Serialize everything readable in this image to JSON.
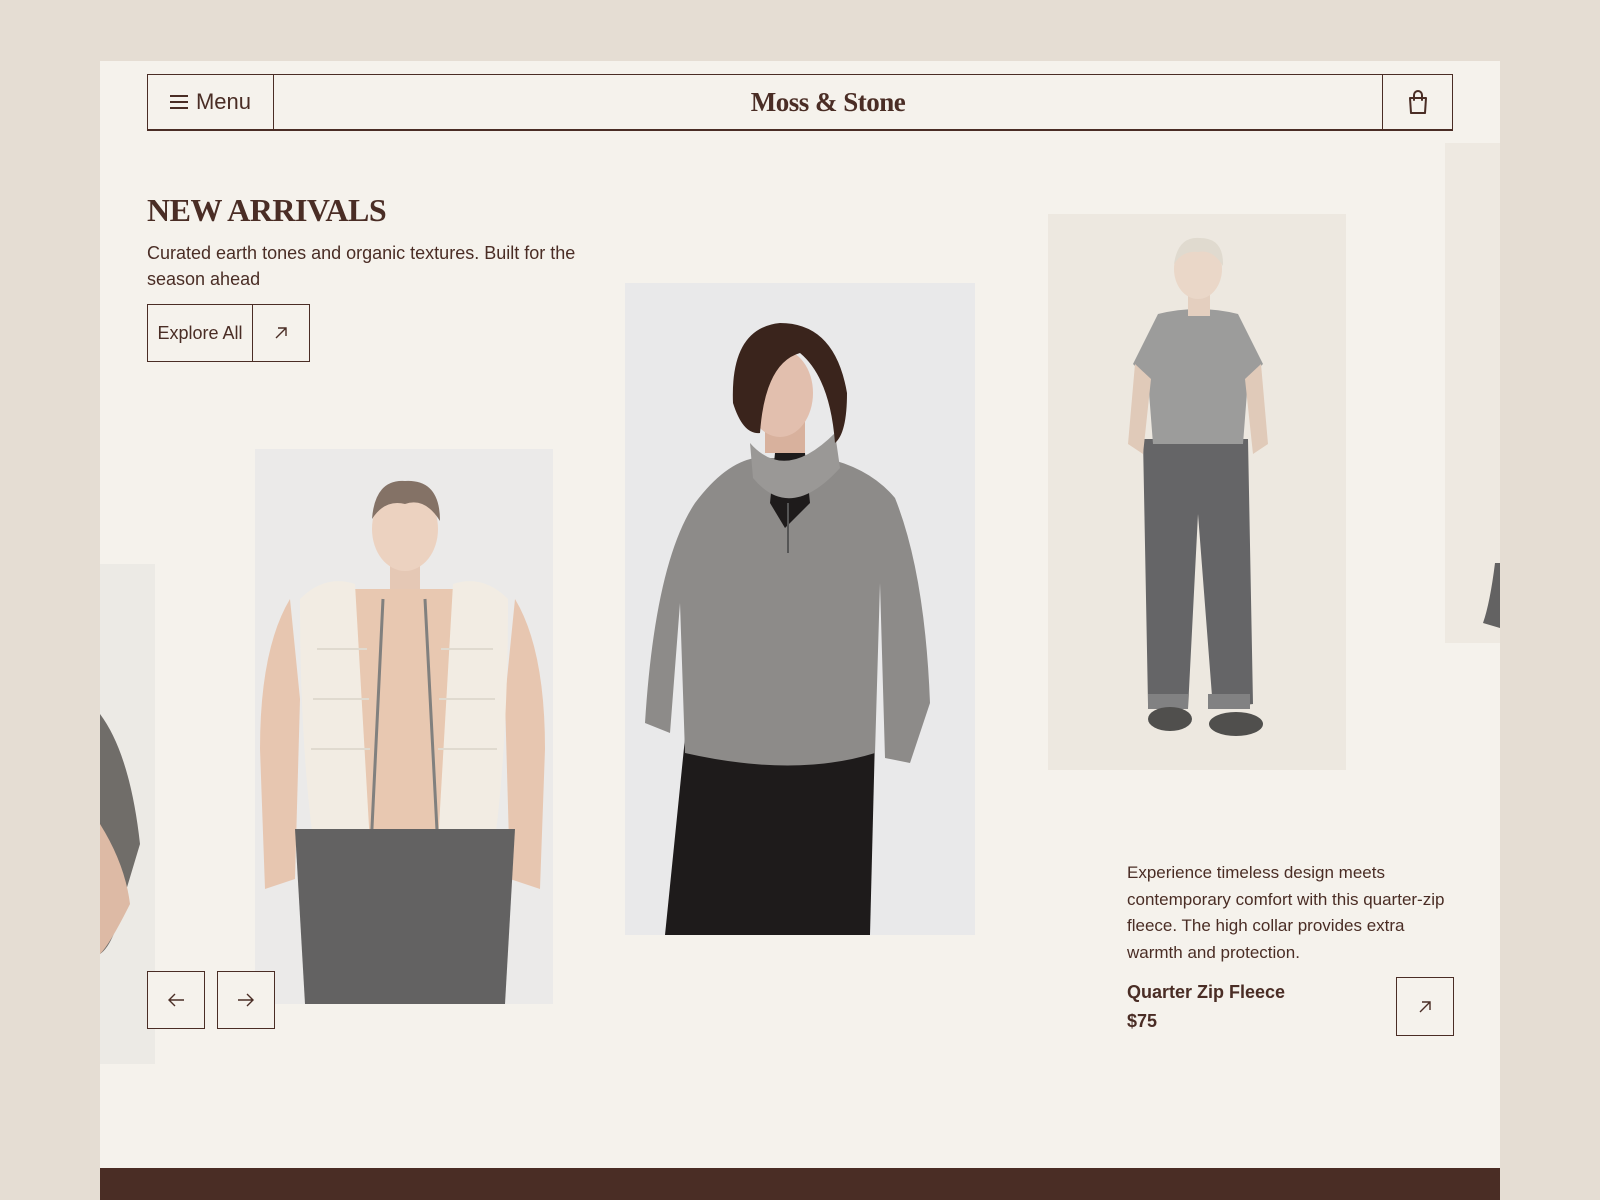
{
  "header": {
    "menu_label": "Menu",
    "brand": "Moss & Stone",
    "menu_icon": "hamburger-icon",
    "cart_icon": "shopping-bag-icon"
  },
  "hero": {
    "title": "NEW ARRIVALS",
    "subtitle": "Curated earth tones and organic textures. Built for the season ahead",
    "explore_label": "Explore All",
    "explore_icon": "arrow-up-right-icon"
  },
  "carousel": {
    "prev_icon": "arrow-left-icon",
    "next_icon": "arrow-right-icon"
  },
  "featured": {
    "description": "Experience timeless design meets contemporary comfort with this quarter-zip fleece. The high collar provides extra warmth and protection.",
    "name": "Quarter Zip Fleece",
    "price": "$75",
    "link_icon": "arrow-up-right-icon"
  },
  "colors": {
    "brand": "#4a2d25",
    "page_bg": "#f5f2ec",
    "outer_bg": "#e5ddd3"
  }
}
